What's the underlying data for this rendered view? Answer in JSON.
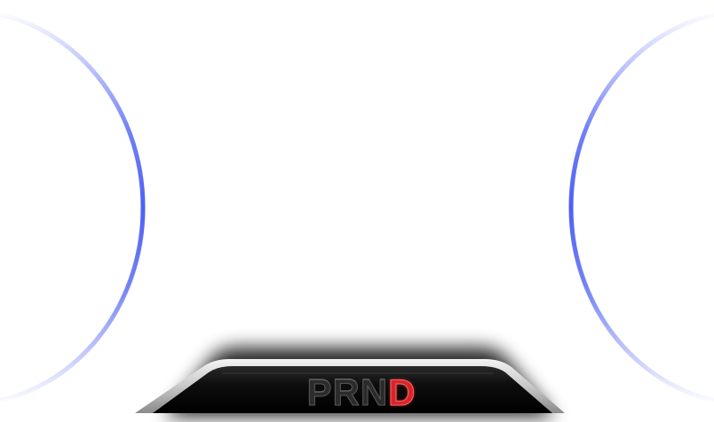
{
  "dashboard": {
    "gear_selector": {
      "gears": [
        {
          "label": "P",
          "active": false
        },
        {
          "label": "R",
          "active": false
        },
        {
          "label": "N",
          "active": false
        },
        {
          "label": "D",
          "active": true
        }
      ],
      "active_gear": "D"
    },
    "colors": {
      "gauge_ring": "#5a6cf5",
      "gear_active": "#d8242a",
      "gear_inactive": "#2b2b2b",
      "console_body": "#0c0c0c",
      "console_trim": "#d4d4d4"
    }
  }
}
